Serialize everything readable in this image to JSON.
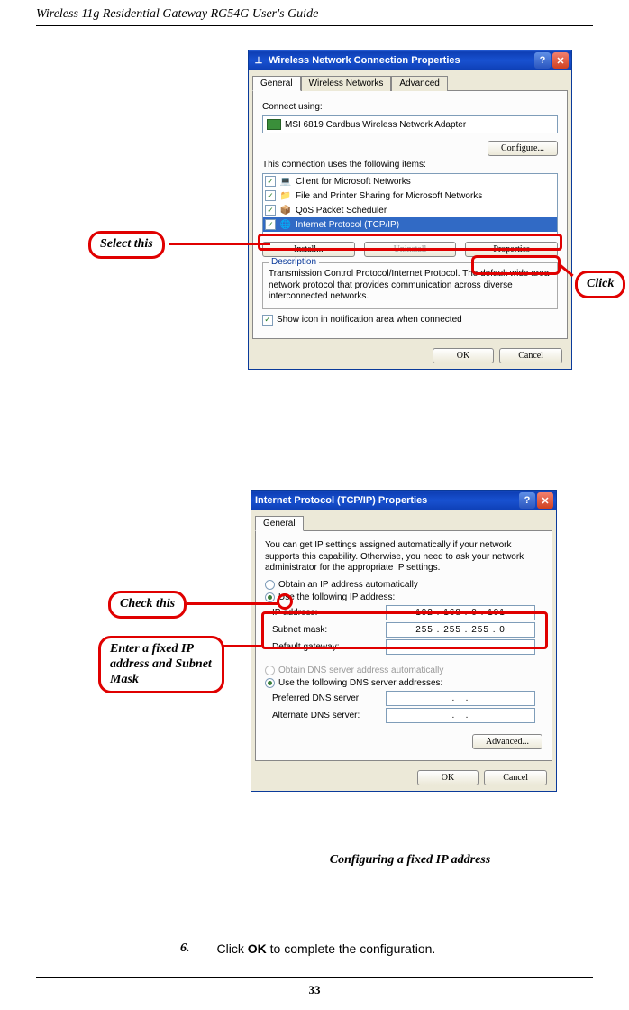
{
  "header": "Wireless 11g Residential Gateway RG54G User's Guide",
  "page_number": "33",
  "callouts": {
    "select_this": "Select this",
    "click": "Click",
    "check_this": "Check this",
    "enter_fixed": "Enter a fixed IP address and Subnet Mask"
  },
  "dialog1": {
    "title": "Wireless Network Connection Properties",
    "tabs": [
      "General",
      "Wireless Networks",
      "Advanced"
    ],
    "connect_using_label": "Connect using:",
    "adapter": "MSI 6819 Cardbus Wireless Network Adapter",
    "configure_btn": "Configure...",
    "items_label": "This connection uses the following items:",
    "items": [
      {
        "label": "Client for Microsoft Networks"
      },
      {
        "label": "File and Printer Sharing for Microsoft Networks"
      },
      {
        "label": "QoS Packet Scheduler"
      },
      {
        "label": "Internet Protocol (TCP/IP)"
      }
    ],
    "install_btn": "Install...",
    "uninstall_btn": "Uninstall",
    "properties_btn": "Properties",
    "desc_title": "Description",
    "desc_text": "Transmission Control Protocol/Internet Protocol. The default wide area network protocol that provides communication across diverse interconnected networks.",
    "show_icon": "Show icon in notification area when connected",
    "ok": "OK",
    "cancel": "Cancel"
  },
  "dialog2": {
    "title": "Internet Protocol (TCP/IP) Properties",
    "tab": "General",
    "intro": "You can get IP settings assigned automatically if your network supports this capability. Otherwise, you need to ask your network administrator for the appropriate IP settings.",
    "obtain_auto": "Obtain an IP address automatically",
    "use_following": "Use the following IP address:",
    "ip_label": "IP address:",
    "ip_value": "192 . 168 .   0   . 101",
    "subnet_label": "Subnet mask:",
    "subnet_value": "255 . 255 . 255 .   0",
    "gateway_label": "Default gateway:",
    "gateway_value": ".       .       .",
    "obtain_dns_auto": "Obtain DNS server address automatically",
    "use_dns": "Use the following DNS server addresses:",
    "pref_dns_label": "Preferred DNS server:",
    "pref_dns_value": ".       .       .",
    "alt_dns_label": "Alternate DNS server:",
    "alt_dns_value": ".       .       .",
    "advanced_btn": "Advanced...",
    "ok": "OK",
    "cancel": "Cancel"
  },
  "caption": "Configuring a fixed IP address",
  "step": {
    "num": "6.",
    "text_before": "Click ",
    "bold": "OK",
    "text_after": " to complete the configuration."
  }
}
